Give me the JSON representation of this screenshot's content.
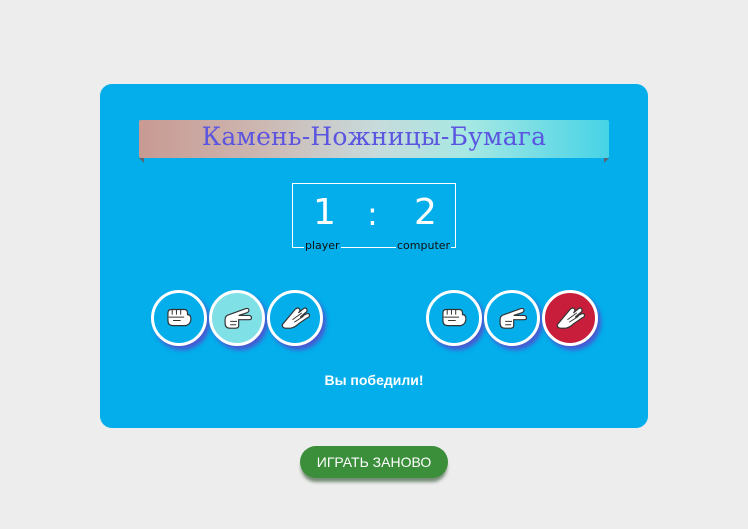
{
  "game": {
    "title": "Камень-Ножницы-Бумага",
    "score": {
      "player": "1",
      "separator": ":",
      "computer": "2",
      "player_label": "player",
      "computer_label": "computer"
    },
    "player_choices": [
      {
        "icon": "rock-hand-icon",
        "state": "normal"
      },
      {
        "icon": "scissors-hand-icon",
        "state": "selected"
      },
      {
        "icon": "paper-hand-icon",
        "state": "normal"
      }
    ],
    "computer_choices": [
      {
        "icon": "rock-hand-icon",
        "state": "normal"
      },
      {
        "icon": "scissors-hand-icon",
        "state": "normal"
      },
      {
        "icon": "paper-hand-icon",
        "state": "winning"
      }
    ],
    "result_text": "Вы победили!",
    "play_again_label": "ИГРАТЬ ЗАНОВО"
  },
  "colors": {
    "background": "#ededed",
    "panel": "#03aeeb",
    "title_text": "#5b55e0",
    "selected_choice": "#7fe0e6",
    "winning_choice": "#c81d3b",
    "play_again_button": "#3b8e3a"
  }
}
